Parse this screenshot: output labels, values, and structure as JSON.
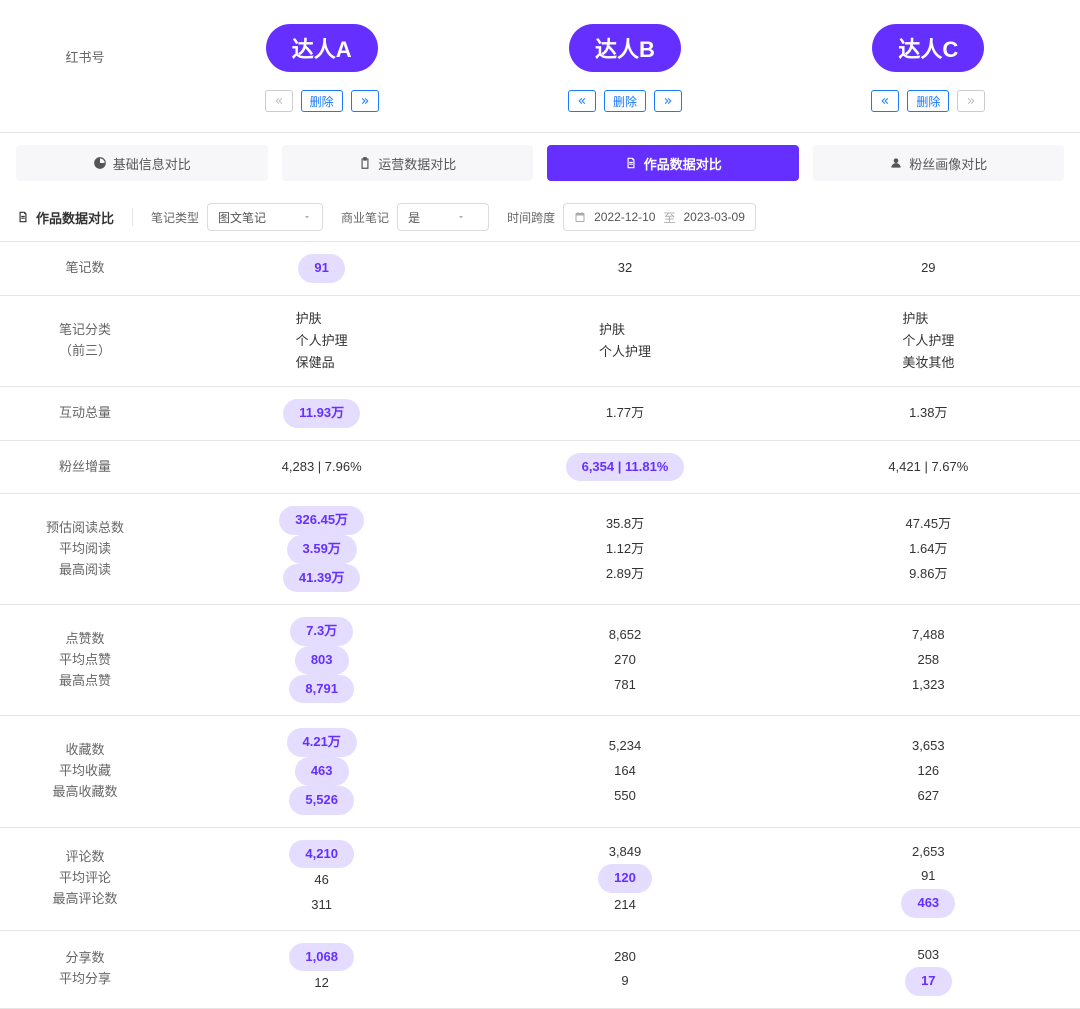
{
  "header_label": "红书号",
  "influencers": [
    {
      "name": "达人A",
      "prev_disabled": true,
      "next_disabled": false
    },
    {
      "name": "达人B",
      "prev_disabled": false,
      "next_disabled": false
    },
    {
      "name": "达人C",
      "prev_disabled": false,
      "next_disabled": true
    }
  ],
  "delete_label": "删除",
  "tabs": [
    {
      "label": "基础信息对比",
      "icon": "dashboard"
    },
    {
      "label": "运营数据对比",
      "icon": "clipboard"
    },
    {
      "label": "作品数据对比",
      "icon": "document",
      "active": true
    },
    {
      "label": "粉丝画像对比",
      "icon": "user"
    }
  ],
  "filter_title": "作品数据对比",
  "filters": {
    "note_type_label": "笔记类型",
    "note_type_value": "图文笔记",
    "biz_label": "商业笔记",
    "biz_value": "是",
    "span_label": "时间跨度",
    "date_from": "2022-12-10",
    "date_sep": "至",
    "date_to": "2023-03-09"
  },
  "rows": [
    {
      "labels": [
        "笔记数"
      ],
      "cells": [
        [
          {
            "v": "91",
            "hl": true
          }
        ],
        [
          {
            "v": "32"
          }
        ],
        [
          {
            "v": "29"
          }
        ]
      ]
    },
    {
      "labels": [
        "笔记分类",
        "（前三）"
      ],
      "cells": [
        [
          {
            "cats": [
              "护肤",
              "个人护理",
              "保健品"
            ]
          }
        ],
        [
          {
            "cats": [
              "护肤",
              "个人护理"
            ]
          }
        ],
        [
          {
            "cats": [
              "护肤",
              "个人护理",
              "美妆其他"
            ]
          }
        ]
      ]
    },
    {
      "labels": [
        "互动总量"
      ],
      "cells": [
        [
          {
            "v": "11.93万",
            "hl": true
          }
        ],
        [
          {
            "v": "1.77万"
          }
        ],
        [
          {
            "v": "1.38万"
          }
        ]
      ]
    },
    {
      "labels": [
        "粉丝增量"
      ],
      "cells": [
        [
          {
            "v": "4,283 | 7.96%"
          }
        ],
        [
          {
            "v": "6,354 | 11.81%",
            "hl": true
          }
        ],
        [
          {
            "v": "4,421 | 7.67%"
          }
        ]
      ]
    },
    {
      "labels": [
        "预估阅读总数",
        "平均阅读",
        "最高阅读"
      ],
      "cells": [
        [
          {
            "v": "326.45万",
            "hl": true
          },
          {
            "v": "3.59万",
            "hl": true
          },
          {
            "v": "41.39万",
            "hl": true
          }
        ],
        [
          {
            "v": "35.8万"
          },
          {
            "v": "1.12万"
          },
          {
            "v": "2.89万"
          }
        ],
        [
          {
            "v": "47.45万"
          },
          {
            "v": "1.64万"
          },
          {
            "v": "9.86万"
          }
        ]
      ]
    },
    {
      "labels": [
        "点赞数",
        "平均点赞",
        "最高点赞"
      ],
      "cells": [
        [
          {
            "v": "7.3万",
            "hl": true
          },
          {
            "v": "803",
            "hl": true
          },
          {
            "v": "8,791",
            "hl": true
          }
        ],
        [
          {
            "v": "8,652"
          },
          {
            "v": "270"
          },
          {
            "v": "781"
          }
        ],
        [
          {
            "v": "7,488"
          },
          {
            "v": "258"
          },
          {
            "v": "1,323"
          }
        ]
      ]
    },
    {
      "labels": [
        "收藏数",
        "平均收藏",
        "最高收藏数"
      ],
      "cells": [
        [
          {
            "v": "4.21万",
            "hl": true
          },
          {
            "v": "463",
            "hl": true
          },
          {
            "v": "5,526",
            "hl": true
          }
        ],
        [
          {
            "v": "5,234"
          },
          {
            "v": "164"
          },
          {
            "v": "550"
          }
        ],
        [
          {
            "v": "3,653"
          },
          {
            "v": "126"
          },
          {
            "v": "627"
          }
        ]
      ]
    },
    {
      "labels": [
        "评论数",
        "平均评论",
        "最高评论数"
      ],
      "cells": [
        [
          {
            "v": "4,210",
            "hl": true
          },
          {
            "v": "46"
          },
          {
            "v": "311"
          }
        ],
        [
          {
            "v": "3,849"
          },
          {
            "v": "120",
            "hl": true
          },
          {
            "v": "214"
          }
        ],
        [
          {
            "v": "2,653"
          },
          {
            "v": "91"
          },
          {
            "v": "463",
            "hl": true
          }
        ]
      ]
    },
    {
      "labels": [
        "分享数",
        "平均分享"
      ],
      "cells": [
        [
          {
            "v": "1,068",
            "hl": true
          },
          {
            "v": "12"
          }
        ],
        [
          {
            "v": "280"
          },
          {
            "v": "9"
          }
        ],
        [
          {
            "v": "503"
          },
          {
            "v": "17",
            "hl": true
          }
        ]
      ]
    }
  ]
}
